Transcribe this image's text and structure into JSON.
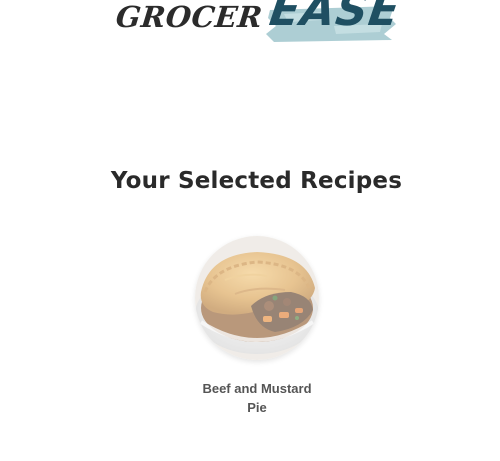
{
  "logo": {
    "part1": "GROCER",
    "part2": "EASE"
  },
  "heading": {
    "title": "Your Selected Recipes"
  },
  "recipes": [
    {
      "name_line1": "Beef and Mustard",
      "name_line2": "Pie",
      "image_icon": "beef-pie-photo"
    }
  ],
  "colors": {
    "logo_dark": "#2b2b2b",
    "logo_accent": "#1f4f62",
    "logo_accent_shadow": "#9fc6cc",
    "title": "#2a2a2a",
    "recipe_text": "#555555",
    "background": "#ffffff"
  }
}
